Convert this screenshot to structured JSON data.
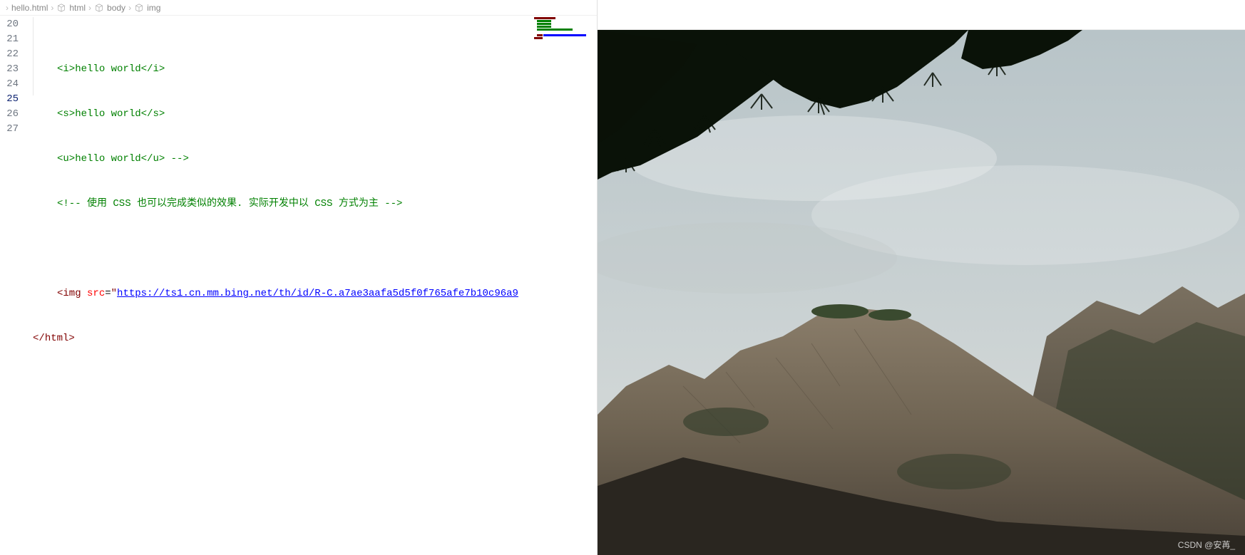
{
  "breadcrumb": {
    "file": "hello.html",
    "path": [
      "html",
      "body",
      "img"
    ]
  },
  "gutter": {
    "start": 20,
    "end": 27,
    "active": 25
  },
  "code": {
    "line20": {
      "tag_open": "<i>",
      "text": "hello world",
      "tag_close": "</i>"
    },
    "line21": {
      "tag_open": "<s>",
      "text": "hello world",
      "tag_close": "</s>"
    },
    "line22": {
      "tag_open": "<u>",
      "text": "hello world",
      "tag_close": "</u>",
      "comment_end": " -->"
    },
    "line23": {
      "comment": "<!-- 使用 CSS 也可以完成类似的效果. 实际开发中以 CSS 方式为主 -->"
    },
    "line25": {
      "tag": "<img",
      "attr": " src",
      "eq": "=",
      "q": "\"",
      "url": "https://ts1.cn.mm.bing.net/th/id/R-C.a7ae3aafa5d5f0f765afe7b10c96a9"
    },
    "line26": {
      "tag": "</html>"
    }
  },
  "watermark": "CSDN @安苒_"
}
